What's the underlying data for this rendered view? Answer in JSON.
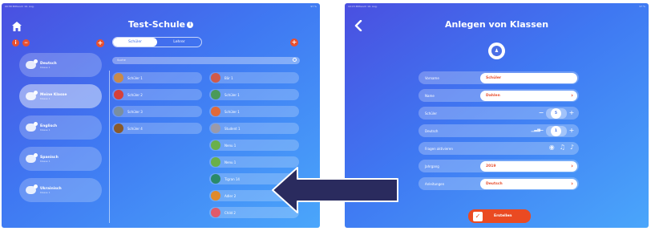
{
  "left": {
    "status_left": "09:58 Mittwoch 16. Aug.",
    "status_right": "97 %",
    "title": "Test-Schule",
    "info_glyph": "i",
    "classes": [
      {
        "name": "Deutsch",
        "sub": "Klasse 1"
      },
      {
        "name": "Meine Klasse",
        "sub": "Klasse 1"
      },
      {
        "name": "Englisch",
        "sub": "Klasse 1"
      },
      {
        "name": "Spanisch",
        "sub": "Klasse 1"
      },
      {
        "name": "Ukrainisch",
        "sub": "Klasse 1"
      }
    ],
    "tabs": {
      "students": "Schüler",
      "teachers": "Lehrer"
    },
    "search_placeholder": "Suche",
    "students": [
      "Schüler 1",
      "Schüler 2",
      "Schüler 3",
      "Schüler 4"
    ],
    "students_right": [
      "Bär 1",
      "Schüler 1",
      "Schüler 1",
      "Student 1",
      "Nenu 1",
      "Nenu 1",
      "Tigran 14",
      "Adler 2",
      "Child 2"
    ]
  },
  "right": {
    "status_left": "10:15 Mittwoch 16. Aug.",
    "status_right": "97 %",
    "title": "Anlegen von Klassen",
    "fields": {
      "vorname": {
        "label": "Vorname",
        "value": "Schüler"
      },
      "name": {
        "label": "Name",
        "value": "Dahlen"
      },
      "schueler": {
        "label": "Schüler",
        "value": "5"
      },
      "deutsch": {
        "label": "Deutsch",
        "value": "1"
      },
      "fragen": {
        "label": "Fragen aktivieren"
      },
      "jahr": {
        "label": "Jahrgang",
        "value": "2019"
      },
      "anleitung": {
        "label": "Anleitungen",
        "value": "Deutsch"
      }
    },
    "create_label": "Erstellen"
  }
}
